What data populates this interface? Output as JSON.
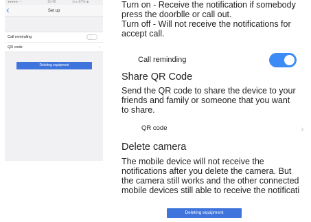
{
  "phone": {
    "status": {
      "carrier": "●●●●● ◠",
      "time": "10:45",
      "sys": "⊙ ▸ 87% ■"
    },
    "nav": {
      "title": "Set up",
      "back_icon": "chevron-left-icon"
    },
    "rows": [
      {
        "label": "Call reminding",
        "toggle_on": false
      },
      {
        "label": "QR code"
      }
    ],
    "delete_button": "Deleting equipment"
  },
  "instructions": {
    "turn_on": [
      "Turn on - Receive the notification if somebody",
      "press the doorblle or call out."
    ],
    "turn_off": [
      "Turn off - Will not receive the notifications for",
      "accept call."
    ],
    "call_reminding_label": "Call reminding",
    "call_reminding_on": true,
    "share_heading": "Share QR Code",
    "share_text": [
      "Send the QR code to share the device to your",
      " friends and family or someone that you want",
      " to share."
    ],
    "qr_label": "QR code",
    "delete_heading": "Delete camera",
    "delete_text": [
      "The mobile device will not receive the",
      "notifications after you delete the camera. But",
      "the camera still works and the other connected",
      "mobile devices still able to receive the notificati"
    ],
    "delete_button": "Deleting equipment"
  },
  "colors": {
    "accent": "#3d8bf5",
    "button": "#3e74dc"
  }
}
